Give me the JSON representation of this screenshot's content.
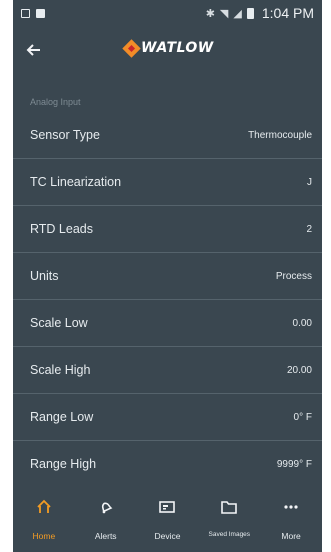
{
  "status_bar": {
    "time": "1:04 PM"
  },
  "section_header": "Analog Input",
  "rows": [
    {
      "label": "Sensor Type",
      "value": "Thermocouple"
    },
    {
      "label": "TC Linearization",
      "value": "J"
    },
    {
      "label": "RTD Leads",
      "value": "2"
    },
    {
      "label": "Units",
      "value": "Process"
    },
    {
      "label": "Scale Low",
      "value": "0.00"
    },
    {
      "label": "Scale High",
      "value": "20.00"
    },
    {
      "label": "Range Low",
      "value": "0° F"
    },
    {
      "label": "Range High",
      "value": "9999° F"
    }
  ],
  "bottom_nav": [
    {
      "label": "Home",
      "icon": "home-icon",
      "active": true
    },
    {
      "label": "Alerts",
      "icon": "bell-icon",
      "active": false
    },
    {
      "label": "Device",
      "icon": "device-icon",
      "active": false
    },
    {
      "label": "Saved Images",
      "icon": "folder-icon",
      "active": false
    },
    {
      "label": "More",
      "icon": "more-icon",
      "active": false
    }
  ],
  "brand": {
    "name": "WATLOW",
    "accent": "#f39c24",
    "background": "#3a4750"
  }
}
